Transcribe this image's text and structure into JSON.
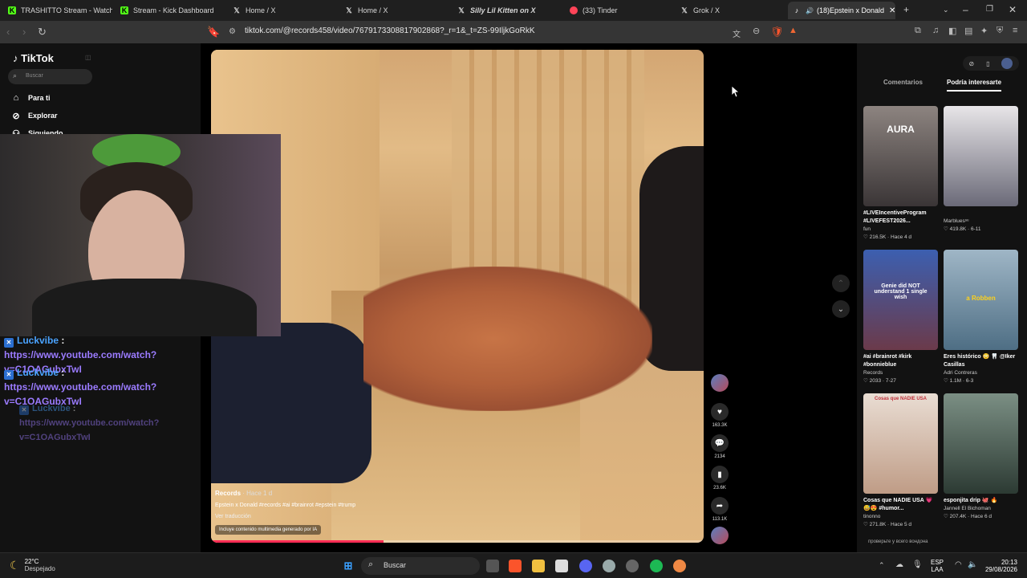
{
  "browser": {
    "tabs": [
      {
        "label": "TRASHITTO Stream - Watch Liv",
        "favicon": "kick-icon"
      },
      {
        "label": "Stream - Kick Dashboard",
        "favicon": "kick-icon"
      },
      {
        "label": "Home / X",
        "favicon": "x-icon"
      },
      {
        "label": "Home / X",
        "favicon": "x-icon"
      },
      {
        "label": "Silly Lil Kitten on X",
        "favicon": "x-icon"
      },
      {
        "label": "(33) Tinder",
        "favicon": "tinder-icon"
      },
      {
        "label": "Grok / X",
        "favicon": "x-icon"
      },
      {
        "label": "(18)Epstein x Donald",
        "favicon": "tiktok-icon"
      }
    ],
    "url": "tiktok.com/@records458/video/7679173308817902868?_r=1&_t=ZS-99IljkGoRkK"
  },
  "sidebar": {
    "logo": "TikTok",
    "search_placeholder": "Buscar",
    "items": [
      {
        "label": "Para ti",
        "icon": "home-icon"
      },
      {
        "label": "Explorar",
        "icon": "compass-icon"
      },
      {
        "label": "Siguiendo",
        "icon": "following-icon"
      }
    ]
  },
  "video": {
    "author": "Records",
    "age": "Hace 1 d",
    "caption": "Epstein x Donald #records #ai #brainrot #epstein #trump",
    "translate": "Ver traducción",
    "ai_notice": "Incluye contenido multimedia generado por IA",
    "progress": 0.35
  },
  "actions": {
    "likes": "163.3K",
    "comments": "2134",
    "saves": "23.6K",
    "shares": "113.1K"
  },
  "panel": {
    "tabs": [
      "Comentarios",
      "Podría interesarte"
    ],
    "cards": [
      {
        "thumb_text": "AURA",
        "title": "#LIVEIncentiveProgram #LIVEFEST2026...",
        "author": "fun",
        "stats": "216.5K · Hace 4 d",
        "color": "#6a5a55"
      },
      {
        "thumb_text": "",
        "title": "",
        "author": "Marbluesˢᵘ",
        "stats": "419.8K · 6-11",
        "color": "#bfbcc0"
      },
      {
        "thumb_text": "Genie did NOT understand 1 single wish",
        "title": "#ai #brainrot #kirk #bonnieblue",
        "author": "Records",
        "stats": "2033 · 7-27",
        "color": "#3e5fa8"
      },
      {
        "thumb_text": "a Robben",
        "title": "Eres histórico 😳 🦷 @Iker Casillas",
        "author": "Adri Contreras",
        "stats": "1.1M · 6-3",
        "color": "#7f9cb3"
      },
      {
        "thumb_text": "Cosas que NADIE USA",
        "title": "Cosas que NADIE USA 💗😅😍 #humor...",
        "author": "tinonno",
        "stats": "271.8K · Hace 5 d",
        "color": "#d5c1b4"
      },
      {
        "thumb_text": "",
        "title": "esponjita drip 🐙 🔥",
        "author": "Jannell El Bichoman",
        "stats": "207.4K · Hace 6 d",
        "color": "#4b6a5c"
      }
    ],
    "next_title": "проверьте у всего вондона"
  },
  "chat": [
    {
      "user": "Luckvibe",
      "text": "https://www.youtube.com/watch?v=C1OAGubxTwI"
    },
    {
      "user": "Luckvibe",
      "text": "https://www.youtube.com/watch?v=C1OAGubxTwI"
    },
    {
      "user": "Luckvibe",
      "text": "https://www.youtube.com/watch?v=C1OAGubxTwI"
    }
  ],
  "taskbar": {
    "weather_temp": "22°C",
    "weather_desc": "Despejado",
    "search": "Buscar",
    "lang": "ESP",
    "lang2": "LAA",
    "time": "20:13",
    "date": "29/08/2026"
  }
}
